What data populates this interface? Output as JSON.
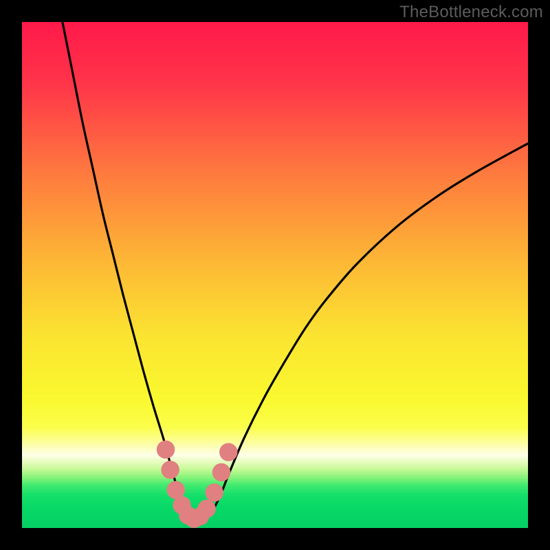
{
  "watermark": "TheBottleneck.com",
  "colors": {
    "frame": "#000000",
    "curve": "#000000",
    "marker_fill": "#e08080",
    "marker_stroke": "#c86e6e"
  },
  "chart_data": {
    "type": "line",
    "title": "",
    "xlabel": "",
    "ylabel": "",
    "xlim": [
      0,
      100
    ],
    "ylim": [
      0,
      100
    ],
    "gradient_stops": [
      {
        "offset": 0.0,
        "color": "#ff1a4a"
      },
      {
        "offset": 0.12,
        "color": "#ff3549"
      },
      {
        "offset": 0.3,
        "color": "#fe7b3e"
      },
      {
        "offset": 0.48,
        "color": "#fdba35"
      },
      {
        "offset": 0.62,
        "color": "#fbe431"
      },
      {
        "offset": 0.74,
        "color": "#faf82e"
      },
      {
        "offset": 0.8,
        "color": "#fbfe4a"
      },
      {
        "offset": 0.835,
        "color": "#fdfeaa"
      },
      {
        "offset": 0.855,
        "color": "#fefee8"
      },
      {
        "offset": 0.87,
        "color": "#e6fcbd"
      },
      {
        "offset": 0.884,
        "color": "#c3f996"
      },
      {
        "offset": 0.9,
        "color": "#86f37a"
      },
      {
        "offset": 0.916,
        "color": "#3fe96f"
      },
      {
        "offset": 0.935,
        "color": "#14e06a"
      },
      {
        "offset": 0.96,
        "color": "#07d866"
      },
      {
        "offset": 1.0,
        "color": "#05d064"
      }
    ],
    "series": [
      {
        "name": "bottleneck-curve",
        "x": [
          8.0,
          10.0,
          12.0,
          14.0,
          16.0,
          18.0,
          20.0,
          22.0,
          24.0,
          26.0,
          28.0,
          29.5,
          31.0,
          33.0,
          35.0,
          37.0,
          39.0,
          41.0,
          44.0,
          48.0,
          52.0,
          56.0,
          60.0,
          66.0,
          74.0,
          82.0,
          90.0,
          100.0
        ],
        "y": [
          100.0,
          90.0,
          80.0,
          71.0,
          62.0,
          54.0,
          46.0,
          38.5,
          31.0,
          24.0,
          17.5,
          12.0,
          7.0,
          3.0,
          1.5,
          2.5,
          6.0,
          11.0,
          18.0,
          26.0,
          33.0,
          39.5,
          45.0,
          52.0,
          59.5,
          65.5,
          70.5,
          76.0
        ]
      }
    ],
    "markers": {
      "name": "highlight-points",
      "x": [
        28.4,
        29.3,
        30.4,
        31.6,
        32.8,
        34.0,
        35.2,
        36.5,
        38.0,
        39.4,
        40.8
      ],
      "y": [
        15.5,
        11.5,
        7.5,
        4.5,
        2.5,
        1.8,
        2.3,
        3.8,
        7.0,
        11.0,
        15.0
      ],
      "radius_pct": 1.8
    }
  }
}
